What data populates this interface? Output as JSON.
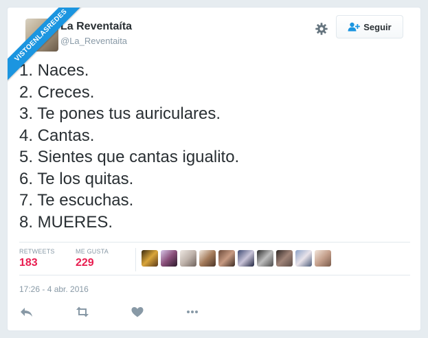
{
  "watermark": "VISTOENLASREDES",
  "user": {
    "name": "La Reventaíta",
    "handle": "@La_Reventaita"
  },
  "header": {
    "follow_label": "Seguir",
    "settings_icon": "gear-icon",
    "follow_icon": "add-user-icon"
  },
  "tweet": {
    "lines": [
      "1. Naces.",
      "2. Creces.",
      "3. Te pones tus auriculares.",
      "4. Cantas.",
      "5. Sientes que cantas igualito.",
      "6. Te los quitas.",
      "7. Te escuchas.",
      "8. MUERES."
    ]
  },
  "stats": {
    "retweets_label": "RETWEETS",
    "retweets_value": "183",
    "likes_label": "ME GUSTA",
    "likes_value": "229"
  },
  "timestamp": "17:26 - 4 abr. 2016",
  "actions": [
    "reply-icon",
    "retweet-icon",
    "like-icon",
    "more-icon"
  ],
  "colors": {
    "accent": "#1b95e0",
    "stat_value": "#e81c4f",
    "text": "#292f33",
    "muted": "#8899a6"
  }
}
